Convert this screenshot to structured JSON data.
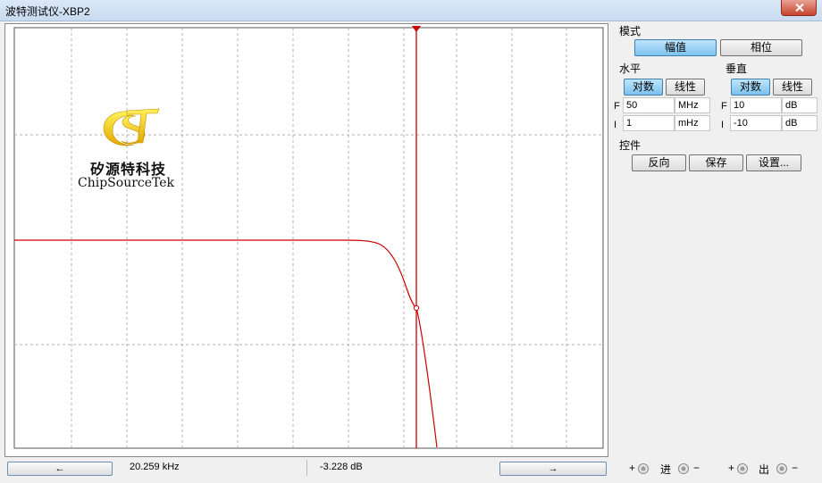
{
  "window": {
    "title": "波特测试仪-XBP2"
  },
  "logo": {
    "cn": "矽源特科技",
    "en": "ChipSourceTek"
  },
  "mode": {
    "label": "模式",
    "magnitude_label": "幅值",
    "phase_label": "相位",
    "selected": "幅值"
  },
  "horizontal": {
    "label": "水平",
    "log_label": "对数",
    "linear_label": "线性",
    "selected": "对数",
    "final": {
      "label": "F",
      "value": "50",
      "unit": "MHz"
    },
    "initial": {
      "label": "I",
      "value": "1",
      "unit": "mHz"
    }
  },
  "vertical": {
    "label": "垂直",
    "log_label": "对数",
    "linear_label": "线性",
    "selected": "对数",
    "final": {
      "label": "F",
      "value": "10",
      "unit": "dB"
    },
    "initial": {
      "label": "I",
      "value": "-10",
      "unit": "dB"
    }
  },
  "controls": {
    "label": "控件",
    "reverse_label": "反向",
    "save_label": "保存",
    "settings_label": "设置..."
  },
  "readout": {
    "left_arrow": "←",
    "right_arrow": "→",
    "frequency": "20.259 kHz",
    "magnitude": "-3.228 dB"
  },
  "terminals": {
    "plus": "+",
    "minus": "−",
    "in_label": "进",
    "out_label": "出"
  },
  "colors": {
    "trace": "#cc0000",
    "cursor": "#cc0000",
    "grid": "#b0b0b0",
    "active_button": "#7cc2ee"
  },
  "plot": {
    "cursor_frequency_khz": 20.259,
    "cursor_magnitude_db": -3.228
  }
}
